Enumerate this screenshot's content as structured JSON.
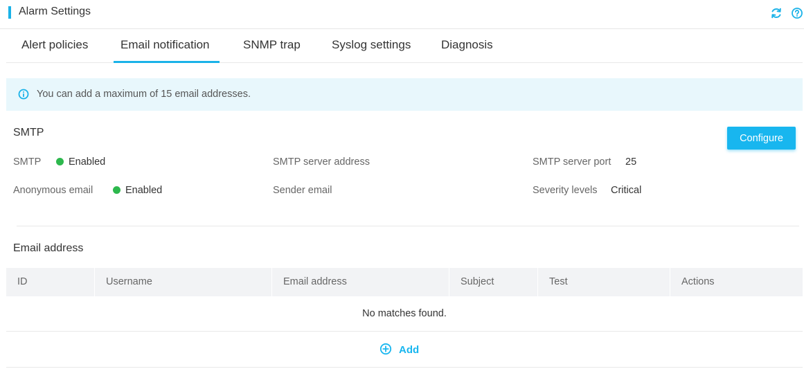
{
  "header": {
    "title": "Alarm Settings",
    "refresh_icon": "refresh-icon",
    "help_icon": "help-icon"
  },
  "tabs": [
    {
      "label": "Alert policies",
      "active": false
    },
    {
      "label": "Email notification",
      "active": true
    },
    {
      "label": "SNMP trap",
      "active": false
    },
    {
      "label": "Syslog settings",
      "active": false
    },
    {
      "label": "Diagnosis",
      "active": false
    }
  ],
  "notice": {
    "icon": "info-icon",
    "text": "You can add a maximum of 15 email addresses."
  },
  "smtp": {
    "title": "SMTP",
    "configure_label": "Configure",
    "fields": {
      "smtp_label": "SMTP",
      "smtp_status": "Enabled",
      "anonymous_label": "Anonymous email",
      "anonymous_status": "Enabled",
      "server_address_label": "SMTP server address",
      "sender_email_label": "Sender email",
      "server_port_label": "SMTP server port",
      "server_port_value": "25",
      "severity_label": "Severity levels",
      "severity_value": "Critical"
    }
  },
  "email_section": {
    "title": "Email address",
    "columns": [
      "ID",
      "Username",
      "Email address",
      "Subject",
      "Test",
      "Actions"
    ],
    "empty_text": "No matches found.",
    "add_label": "Add"
  },
  "colors": {
    "accent": "#1ab2e8",
    "enabled": "#2db84d",
    "notice_bg": "#e8f7fc"
  }
}
